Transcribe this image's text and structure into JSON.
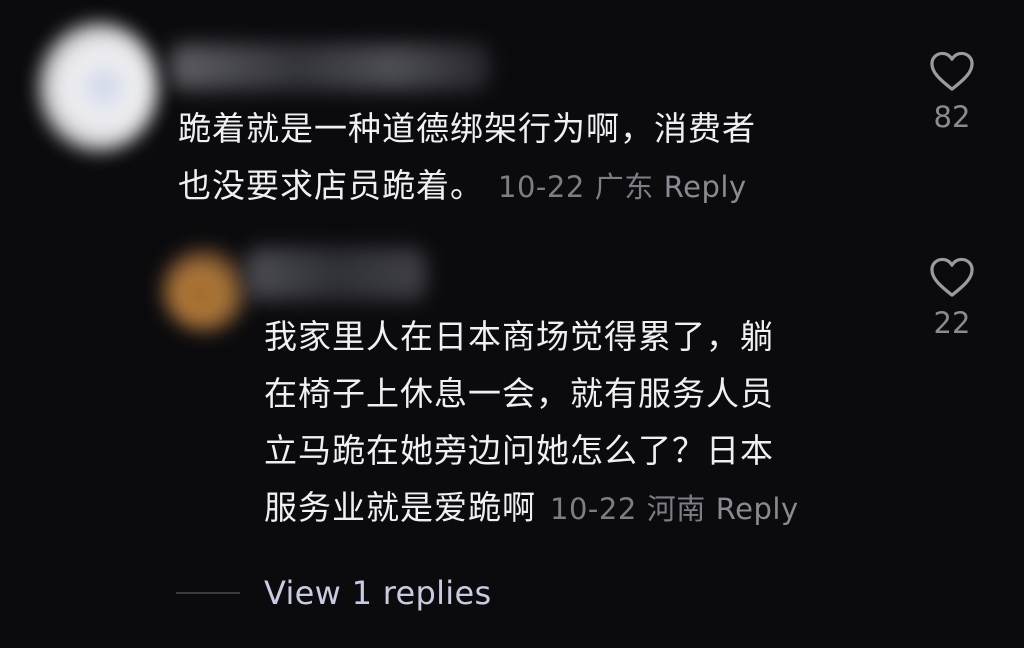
{
  "comments": [
    {
      "lines": [
        "跪着就是一种道德绑架行为啊，消费者",
        "也没要求店员跪着。"
      ],
      "date": "10-22",
      "location": "广东",
      "reply_label": "Reply",
      "likes": "82"
    },
    {
      "lines": [
        "我家里人在日本商场觉得累了，躺",
        "在椅子上休息一会，就有服务人员",
        "立马跪在她旁边问她怎么了？日本",
        "服务业就是爱跪啊"
      ],
      "date": "10-22",
      "location": "河南",
      "reply_label": "Reply",
      "likes": "22"
    }
  ],
  "view_replies_label": "View 1 replies",
  "colors": {
    "background": "#0b0b0e",
    "text": "#f0f0f3",
    "meta": "#7d7d85",
    "link": "#c9cbe0"
  },
  "icons": {
    "like": "heart-outline-icon",
    "avatar": "blurred-avatar"
  }
}
